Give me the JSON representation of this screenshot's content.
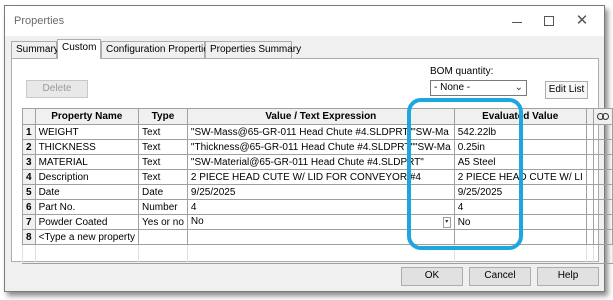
{
  "window": {
    "title": "Properties"
  },
  "tabs": [
    {
      "label": "Summary"
    },
    {
      "label": "Custom"
    },
    {
      "label": "Configuration Properties"
    },
    {
      "label": "Properties Summary"
    }
  ],
  "toolbar": {
    "delete_label": "Delete",
    "bom_label": "BOM quantity:",
    "bom_value": "- None -",
    "edit_list_label": "Edit List"
  },
  "grid": {
    "headers": {
      "name": "Property Name",
      "type": "Type",
      "value": "Value / Text Expression",
      "evaluated": "Evaluated Value"
    },
    "rows": [
      {
        "num": "1",
        "name": "WEIGHT",
        "type": "Text",
        "value": "\"SW-Mass@65-GR-011 Head Chute #4.SLDPRT\"\"SW-Ma",
        "evaluated": "542.22lb"
      },
      {
        "num": "2",
        "name": "THICKNESS",
        "type": "Text",
        "value": "\"Thickness@65-GR-011 Head Chute #4.SLDPRT\"\"SW-Ma",
        "evaluated": "0.25in"
      },
      {
        "num": "3",
        "name": "MATERIAL",
        "type": "Text",
        "value": "\"SW-Material@65-GR-011 Head Chute #4.SLDPRT\"",
        "evaluated": "A5 Steel"
      },
      {
        "num": "4",
        "name": "Description",
        "type": "Text",
        "value": "2 PIECE HEAD CUTE W/ LID FOR CONVEYOR #4",
        "evaluated": "2 PIECE HEAD CUTE W/ LI"
      },
      {
        "num": "5",
        "name": "Date",
        "type": "Date",
        "value": "9/25/2025",
        "evaluated": "9/25/2025"
      },
      {
        "num": "6",
        "name": "Part No.",
        "type": "Number",
        "value": "4",
        "evaluated": "4"
      },
      {
        "num": "7",
        "name": "Powder Coated",
        "type": "Yes or no",
        "value": "No",
        "evaluated": "No"
      },
      {
        "num": "8",
        "name": "<Type a new property",
        "type": "",
        "value": "",
        "evaluated": ""
      }
    ]
  },
  "footer": {
    "ok_label": "OK",
    "cancel_label": "Cancel",
    "help_label": "Help"
  },
  "colors": {
    "highlight": "#1ea7de",
    "window_bg": "#f0f0f0"
  },
  "icons": [
    "minimize-icon",
    "maximize-icon",
    "close-icon",
    "link-icon",
    "chevron-down-icon"
  ]
}
